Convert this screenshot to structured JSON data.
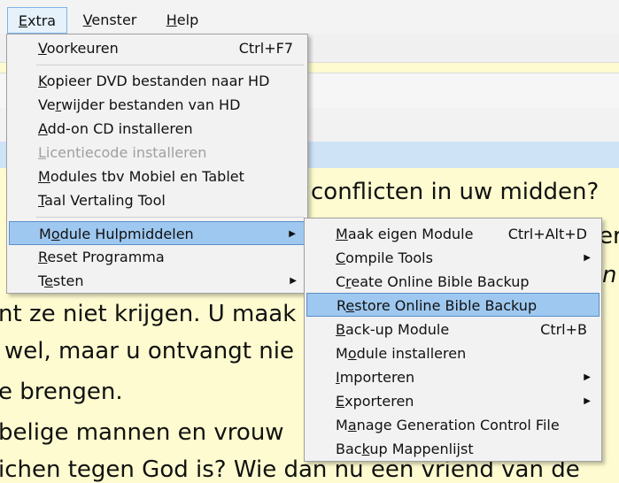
{
  "menubar": {
    "items": [
      {
        "key": "E",
        "rest": "xtra"
      },
      {
        "key": "V",
        "rest": "enster"
      },
      {
        "key": "H",
        "rest": "elp"
      }
    ]
  },
  "content": {
    "lines": [
      "conflicten in uw midden?",
      "er",
      "n",
      "nt ze niet krijgen. U maak",
      "wel, maar u ontvangt nie",
      "e brengen.",
      "belige mannen en vrouw",
      "ichen tegen God is? Wie dan nu een vriend van de"
    ]
  },
  "extra_menu": {
    "items": [
      {
        "pre": "",
        "key": "V",
        "rest": "oorkeuren",
        "shortcut": "Ctrl+F7"
      },
      {
        "pre": "",
        "key": "K",
        "rest": "opieer DVD bestanden naar HD"
      },
      {
        "pre": "Ve",
        "key": "r",
        "rest": "wijder bestanden van HD"
      },
      {
        "pre": "",
        "key": "A",
        "rest": "dd-on CD installeren"
      },
      {
        "pre": "",
        "key": "L",
        "rest": "icentiecode installeren"
      },
      {
        "pre": "",
        "key": "M",
        "rest": "odules tbv Mobiel en Tablet"
      },
      {
        "pre": "",
        "key": "T",
        "rest": "aal Vertaling Tool"
      },
      {
        "pre": "M",
        "key": "o",
        "rest": "dule Hulpmiddelen"
      },
      {
        "pre": "",
        "key": "R",
        "rest": "eset Programma"
      },
      {
        "pre": "T",
        "key": "e",
        "rest": "sten"
      }
    ]
  },
  "sub_menu": {
    "items": [
      {
        "pre": "",
        "key": "M",
        "rest": "aak eigen Module",
        "shortcut": "Ctrl+Alt+D"
      },
      {
        "pre": "",
        "key": "C",
        "rest": "ompile Tools"
      },
      {
        "pre": "C",
        "key": "r",
        "rest": "eate Online Bible Backup"
      },
      {
        "pre": "R",
        "key": "e",
        "rest": "store Online Bible Backup"
      },
      {
        "pre": "",
        "key": "B",
        "rest": "ack-up Module",
        "shortcut": "Ctrl+B"
      },
      {
        "pre": "M",
        "key": "o",
        "rest": "dule installeren"
      },
      {
        "pre": "",
        "key": "I",
        "rest": "mporteren"
      },
      {
        "pre": "",
        "key": "E",
        "rest": "xporteren"
      },
      {
        "pre": "M",
        "key": "a",
        "rest": "nage Generation Control File"
      },
      {
        "pre": "Bac",
        "key": "k",
        "rest": "up Mappenlijst"
      }
    ]
  }
}
